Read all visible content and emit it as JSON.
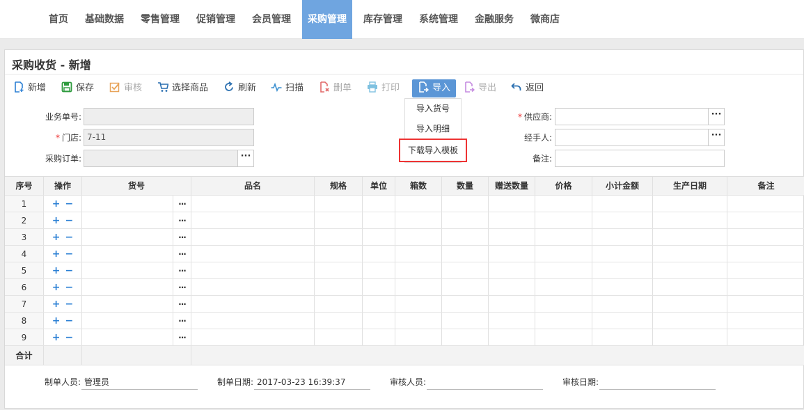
{
  "nav": {
    "items": [
      {
        "label": "首页"
      },
      {
        "label": "基础数据"
      },
      {
        "label": "零售管理"
      },
      {
        "label": "促销管理"
      },
      {
        "label": "会员管理"
      },
      {
        "label": "采购管理"
      },
      {
        "label": "库存管理"
      },
      {
        "label": "系统管理"
      },
      {
        "label": "金融服务"
      },
      {
        "label": "微商店"
      }
    ],
    "active": "采购管理"
  },
  "page": {
    "title": "采购收货 - 新增"
  },
  "toolbar": {
    "new": "新增",
    "save": "保存",
    "audit": "审核",
    "select_goods": "选择商品",
    "refresh": "刷新",
    "scan": "扫描",
    "delete": "删单",
    "print": "打印",
    "import": "导入",
    "export": "导出",
    "back": "返回"
  },
  "import_menu": {
    "items": [
      "导入货号",
      "导入明细",
      "下载导入模板"
    ]
  },
  "form": {
    "order_no_label": "业务单号:",
    "order_no_value": "",
    "store_label": "门店:",
    "store_value": "7-11",
    "po_label": "采购订单:",
    "po_value": "",
    "supplier_label": "供应商:",
    "supplier_value": "",
    "handler_label": "经手人:",
    "handler_value": "",
    "remark_label": "备注:",
    "remark_value": "",
    "more": "···"
  },
  "grid": {
    "headers": [
      "序号",
      "操作",
      "货号",
      "品名",
      "规格",
      "单位",
      "箱数",
      "数量",
      "赠送数量",
      "价格",
      "小计金额",
      "生产日期",
      "备注"
    ],
    "rows": [
      "1",
      "2",
      "3",
      "4",
      "5",
      "6",
      "7",
      "8",
      "9"
    ],
    "plus": "+",
    "minus": "−",
    "more": "···",
    "total_label": "合计"
  },
  "footer": {
    "creator_label": "制单人员:",
    "creator_value": "管理员",
    "created_label": "制单日期:",
    "created_value": "2017-03-23 16:39:37",
    "auditor_label": "审核人员:",
    "auditor_value": "",
    "audit_date_label": "审核日期:",
    "audit_date_value": ""
  },
  "colors": {
    "nav_active": "#6fa5e0",
    "import_button": "#5b96d6",
    "highlight_box": "#e33333",
    "accent_blue": "#2a7fd4"
  }
}
